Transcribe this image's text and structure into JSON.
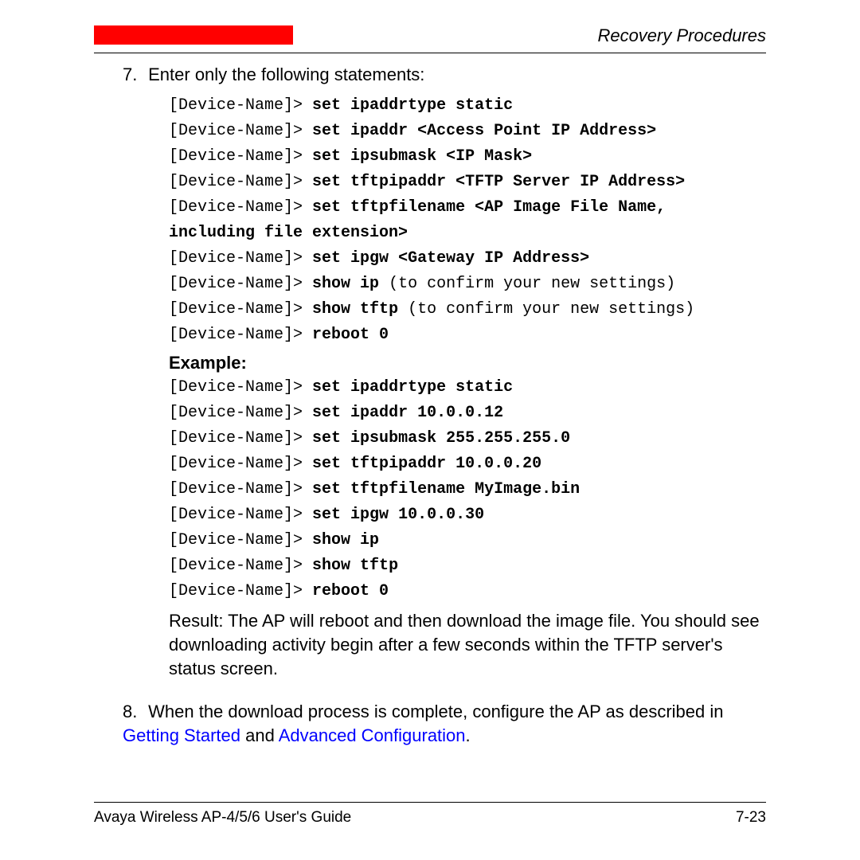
{
  "header": {
    "title": "Recovery Procedures"
  },
  "step7": {
    "num": "7.",
    "text": "Enter only the following statements:"
  },
  "prompt": "[Device-Name]>",
  "cmds1": {
    "l1": "set ipaddrtype static",
    "l2": "set ipaddr <Access Point IP Address>",
    "l3": "set ipsubmask <IP Mask>",
    "l4": "set tftpipaddr <TFTP Server IP Address>",
    "l5": "set tftpfilename <AP Image File Name,",
    "l5b": "including file extension>",
    "l6": "set ipgw <Gateway IP Address>",
    "l7": "show ip",
    "l7n": " (to confirm your new settings)",
    "l8": "show tftp",
    "l8n": " (to confirm your new settings)",
    "l9": "reboot 0"
  },
  "example_label": "Example:",
  "cmds2": {
    "l1": "set ipaddrtype static",
    "l2": "set ipaddr 10.0.0.12",
    "l3": "set ipsubmask 255.255.255.0",
    "l4": "set tftpipaddr 10.0.0.20",
    "l5": "set tftpfilename MyImage.bin",
    "l6": "set ipgw 10.0.0.30",
    "l7": "show ip",
    "l8": "show tftp",
    "l9": "reboot 0"
  },
  "result": "Result: The AP will reboot and then download the image file. You should see downloading activity begin after a few seconds within the TFTP server's status screen.",
  "step8": {
    "num": "8.",
    "pre": "When the download process is complete, configure the AP as described in ",
    "link1": "Getting Started",
    "mid": " and ",
    "link2": "Advanced Configuration",
    "post": "."
  },
  "footer": {
    "left": "Avaya Wireless AP-4/5/6 User's Guide",
    "right": "7-23"
  }
}
